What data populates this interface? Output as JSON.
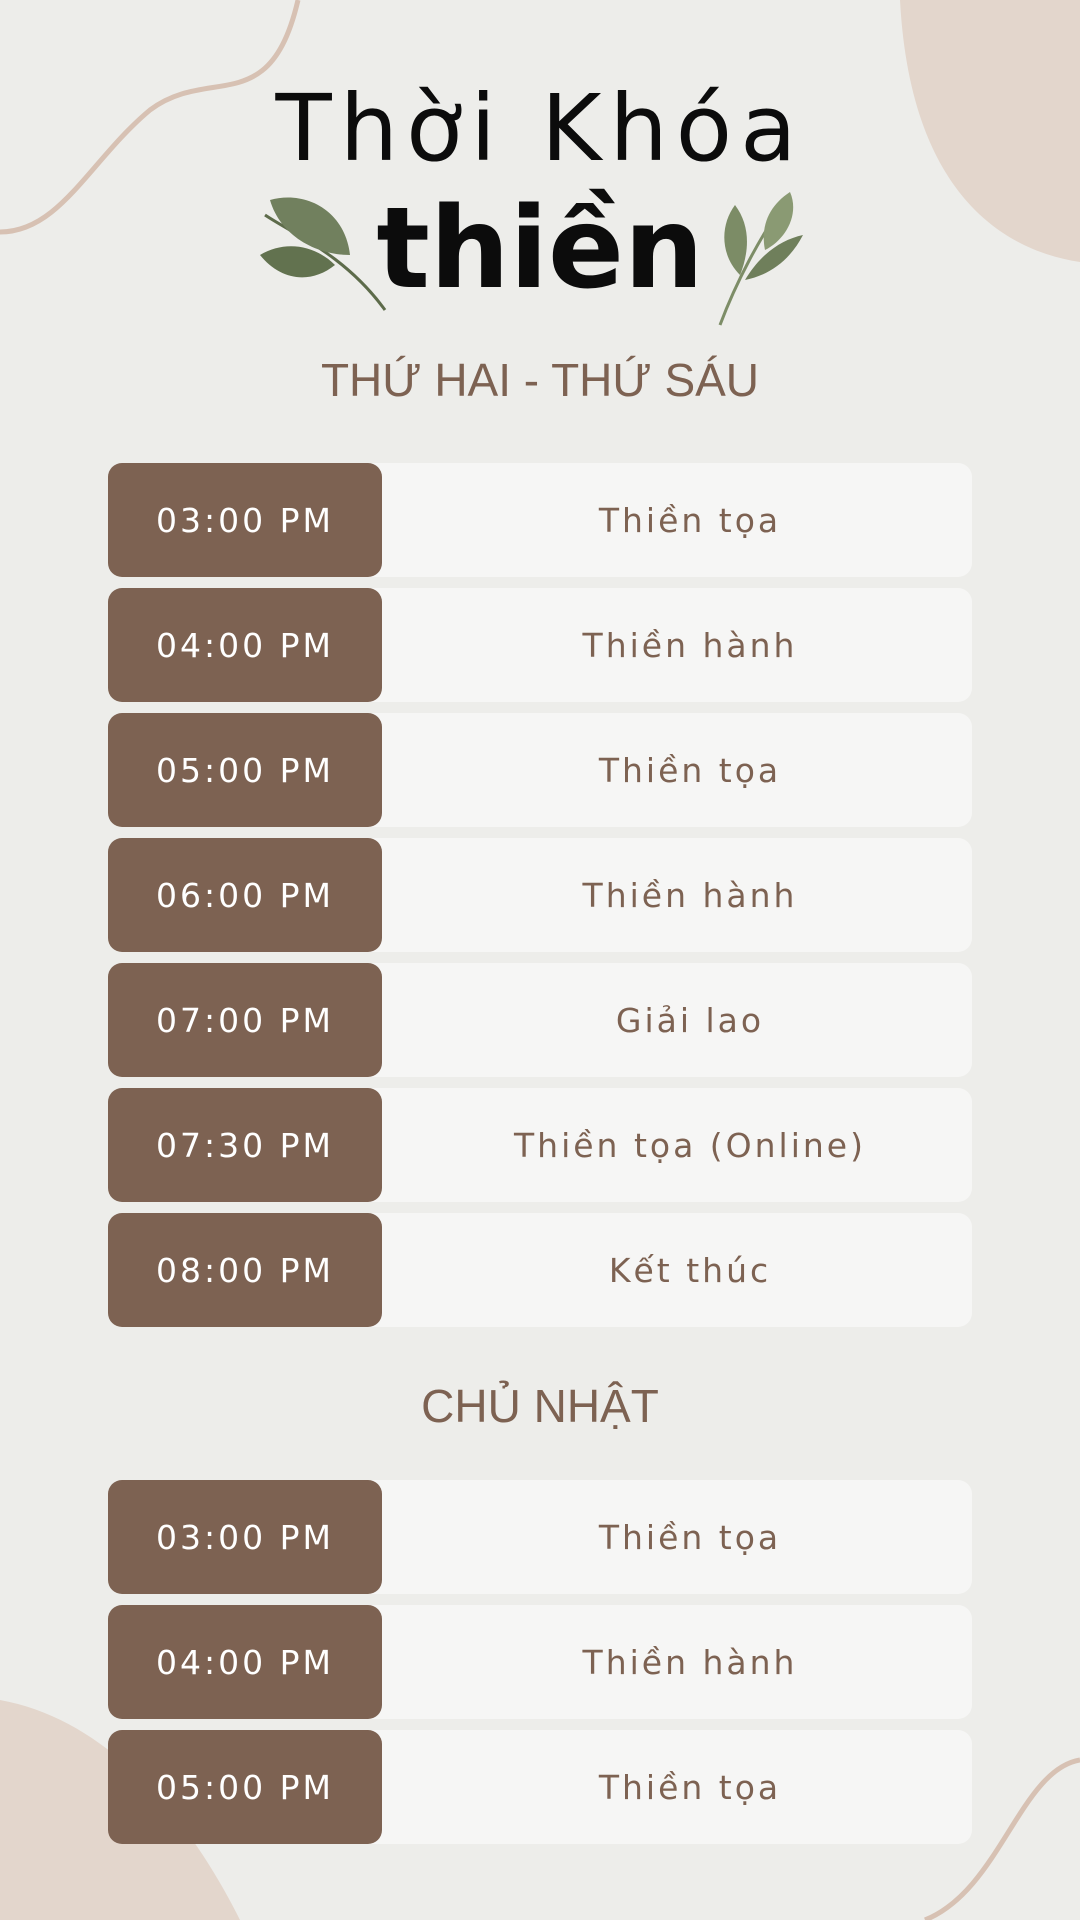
{
  "title": {
    "line1": "Thời Khóa",
    "line2": "thiền"
  },
  "colors": {
    "background": "#ededea",
    "accent": "#7d6252",
    "row": "#f6f6f5",
    "decor": "#e3d6cc",
    "leaf": "#6f805a"
  },
  "icons": {
    "left_leaf": "leaf-sprig-icon",
    "right_leaf": "leaf-sprig-icon"
  },
  "weekday": {
    "heading": "THỨ HAI - THỨ SÁU",
    "rows": [
      {
        "time": "03:00 PM",
        "activity": "Thiền tọa"
      },
      {
        "time": "04:00 PM",
        "activity": "Thiền hành"
      },
      {
        "time": "05:00 PM",
        "activity": "Thiền tọa"
      },
      {
        "time": "06:00 PM",
        "activity": "Thiền hành"
      },
      {
        "time": "07:00 PM",
        "activity": "Giải lao"
      },
      {
        "time": "07:30 PM",
        "activity": "Thiền tọa (Online)"
      },
      {
        "time": "08:00 PM",
        "activity": "Kết thúc"
      }
    ]
  },
  "sunday": {
    "heading": "CHỦ NHẬT",
    "rows": [
      {
        "time": "03:00 PM",
        "activity": "Thiền tọa"
      },
      {
        "time": "04:00 PM",
        "activity": "Thiền hành"
      },
      {
        "time": "05:00 PM",
        "activity": "Thiền tọa"
      }
    ]
  }
}
